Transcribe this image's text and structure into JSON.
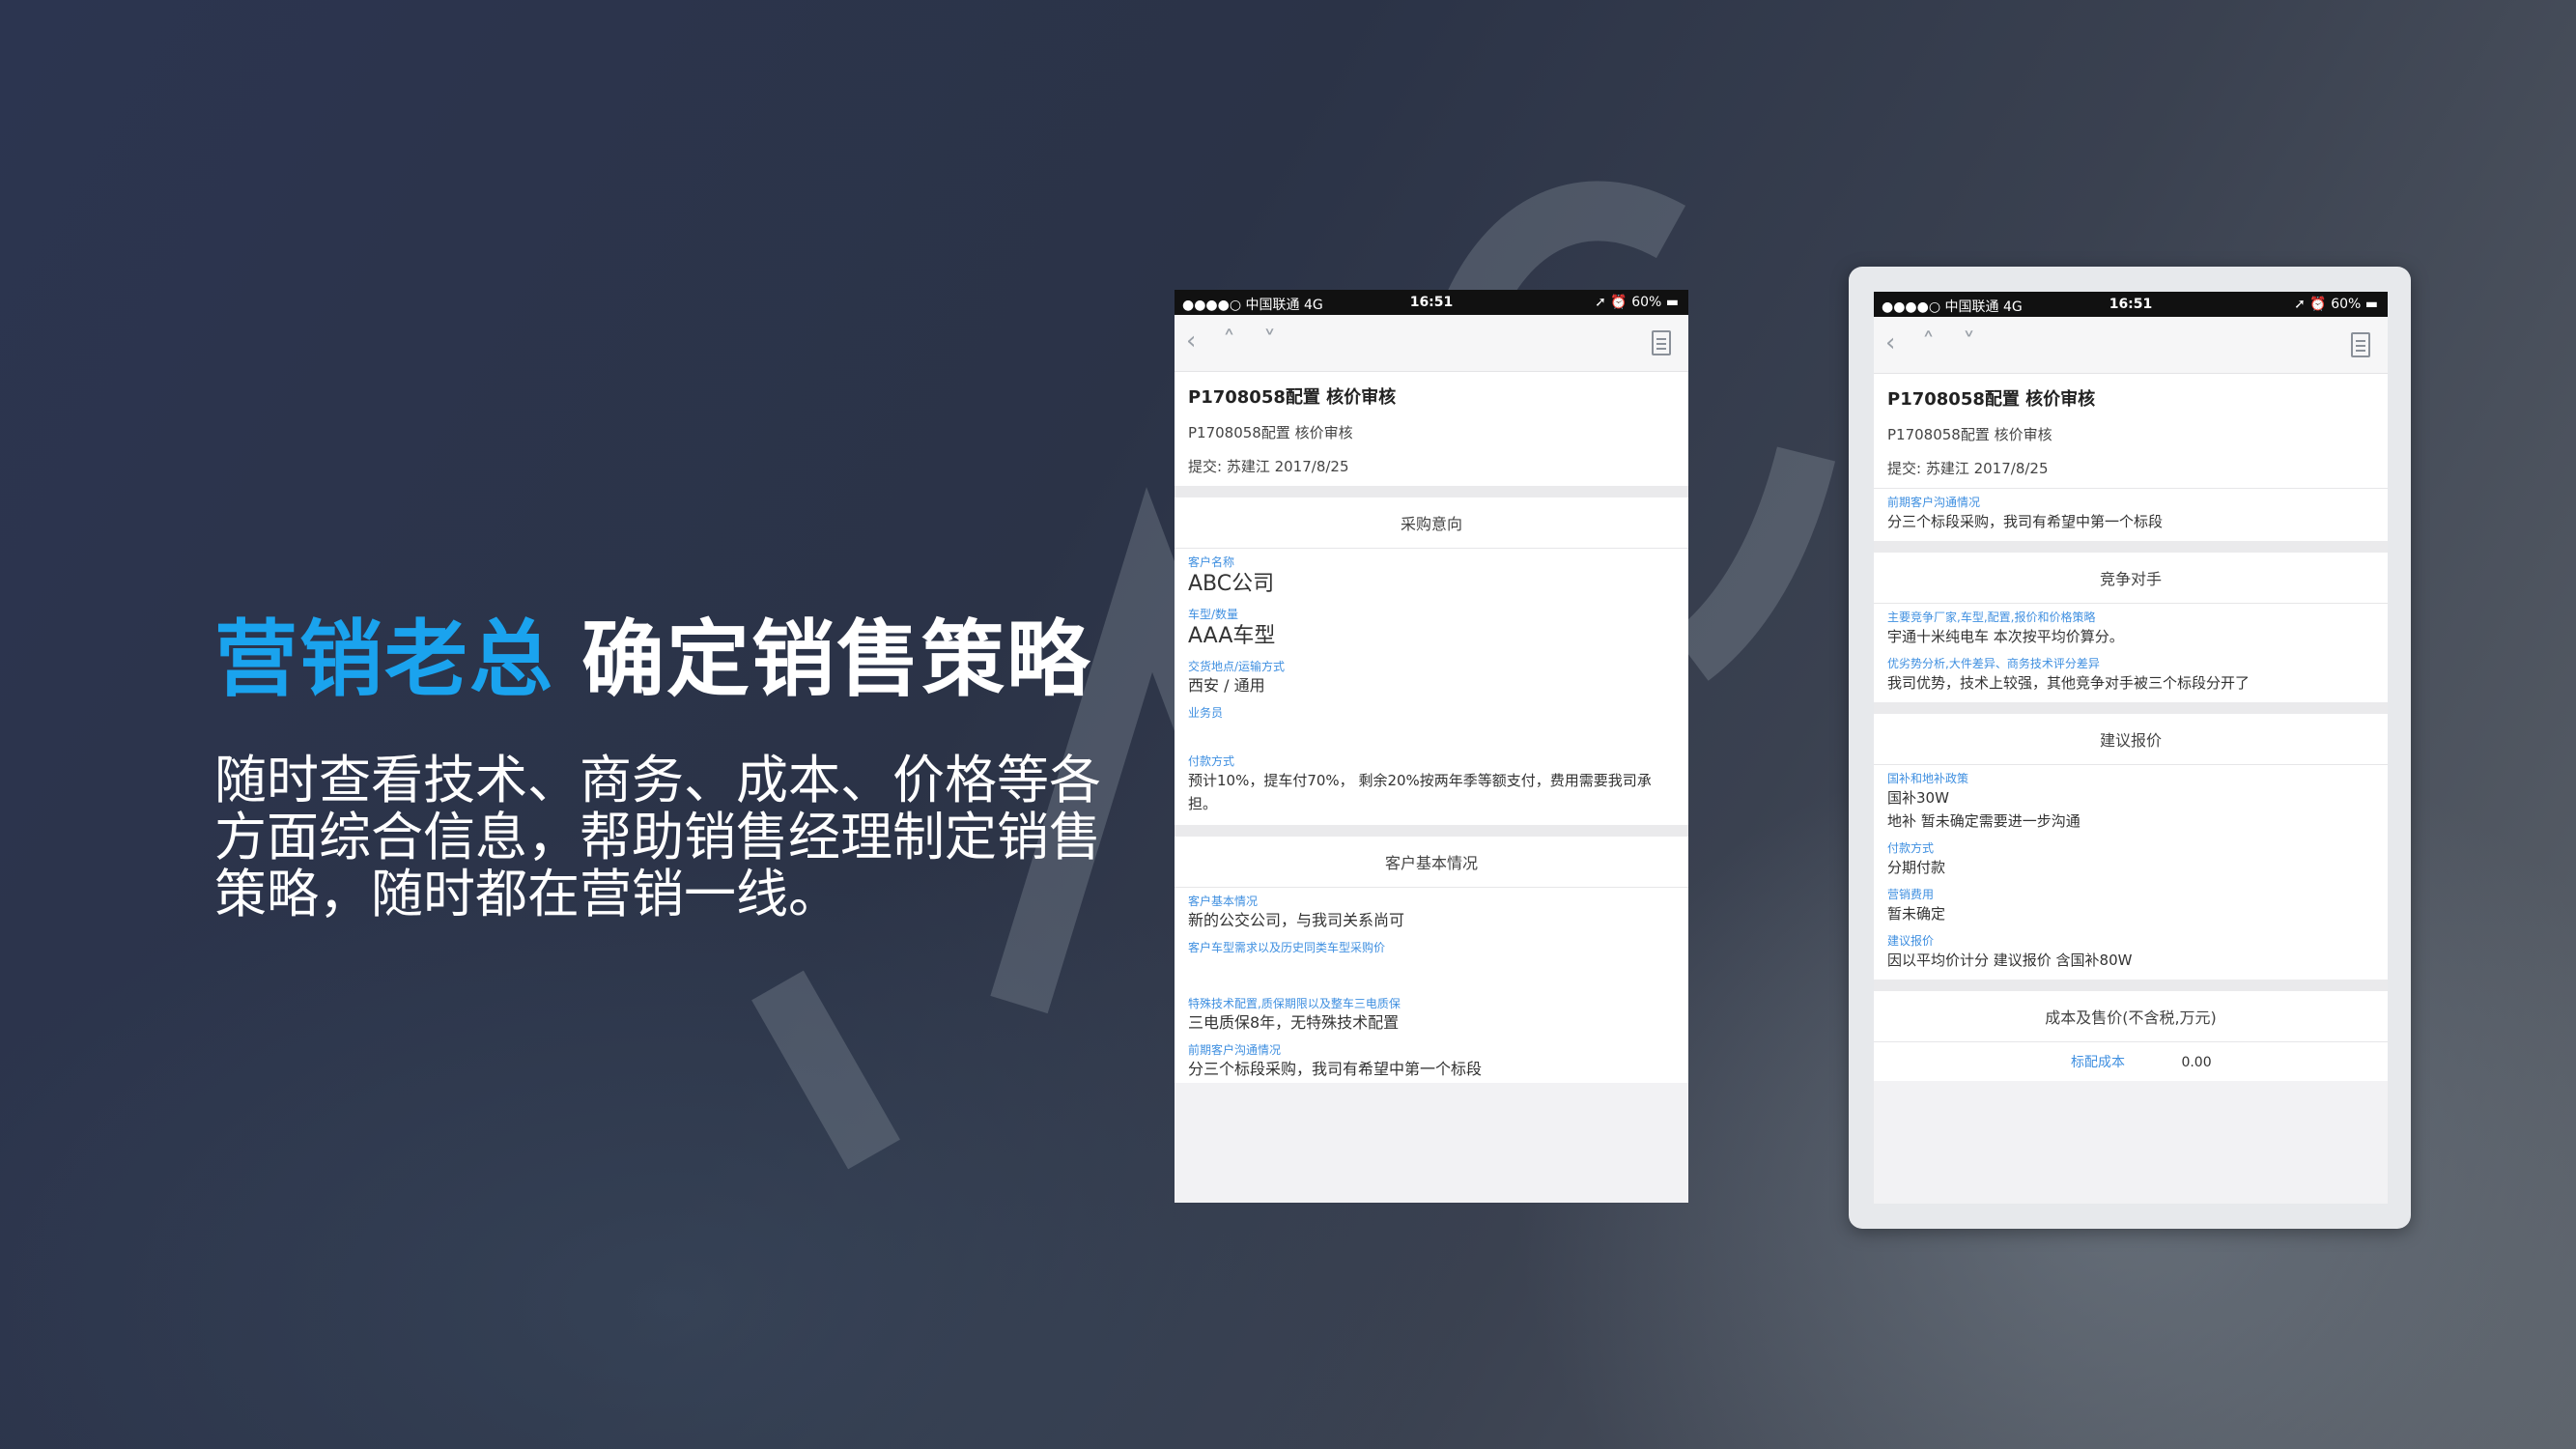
{
  "slide": {
    "headline_accent": "营销老总",
    "headline_rest": "确定销售策略",
    "body": "随时查看技术、商务、成本、价格等各方面综合信息，帮助销售经理制定销售策略，随时都在营销一线。",
    "watermark": "IMC",
    "colors": {
      "accent": "#1aa3ee",
      "link_label": "#3f8fe0"
    }
  },
  "phone1": {
    "status": {
      "carrier": "●●●●○ 中国联通  4G",
      "time": "16:51",
      "battery": "➚ ⏰ 60% ▬"
    },
    "nav": {
      "back_icon": "chevron-left-icon",
      "up_icon": "chevron-up-icon",
      "down_icon": "chevron-down-icon",
      "doc_icon": "document-icon"
    },
    "summary": {
      "title": "P1708058配置 核价审核",
      "subtitle": "P1708058配置 核价审核",
      "meta": "提交: 苏建江 2017/8/25"
    },
    "section1": {
      "title": "采购意向",
      "fields": [
        {
          "label": "客户名称",
          "value": "ABC公司"
        },
        {
          "label": "车型/数量",
          "value": "AAA车型"
        },
        {
          "label": "交货地点/运输方式",
          "value": "西安 / 通用"
        },
        {
          "label": "业务员",
          "value": ""
        },
        {
          "label": "付款方式",
          "value": "预计10%，提车付70%， 剩余20%按两年季等额支付，费用需要我司承担。"
        }
      ]
    },
    "section2": {
      "title": "客户基本情况",
      "fields": [
        {
          "label": "客户基本情况",
          "value": "新的公交公司，与我司关系尚可"
        },
        {
          "label": "客户车型需求以及历史同类车型采购价",
          "value": ""
        },
        {
          "label": "特殊技术配置,质保期限以及整车三电质保",
          "value": "三电质保8年，无特殊技术配置"
        },
        {
          "label": "前期客户沟通情况",
          "value": "分三个标段采购，我司有希望中第一个标段"
        }
      ]
    }
  },
  "phone2": {
    "status": {
      "carrier": "●●●●○ 中国联通  4G",
      "time": "16:51",
      "battery": "➚ ⏰ 60% ▬"
    },
    "summary": {
      "title": "P1708058配置 核价审核",
      "subtitle": "P1708058配置 核价审核",
      "meta": "提交: 苏建江 2017/8/25"
    },
    "pre_field": {
      "label": "前期客户沟通情况",
      "value": "分三个标段采购，我司有希望中第一个标段"
    },
    "competitors": {
      "title": "竞争对手",
      "fields": [
        {
          "label": "主要竞争厂家,车型,配置,报价和价格策略",
          "value": "宇通十米纯电车  本次按平均价算分。"
        },
        {
          "label": "优劣势分析,大件差异、商务技术评分差异",
          "value": "我司优势，技术上较强，其他竞争对手被三个标段分开了"
        }
      ]
    },
    "suggested": {
      "title": "建议报价",
      "fields": [
        {
          "label": "国补和地补政策",
          "value": "国补30W\n地补  暂未确定需要进一步沟通"
        },
        {
          "label": "付款方式",
          "value": "分期付款"
        },
        {
          "label": "营销费用",
          "value": "暂未确定"
        },
        {
          "label": "建议报价",
          "value": "因以平均价计分    建议报价  含国补80W"
        }
      ]
    },
    "cost": {
      "title": "成本及售价(不含税,万元)",
      "label": "标配成本",
      "value": "0.00"
    }
  }
}
